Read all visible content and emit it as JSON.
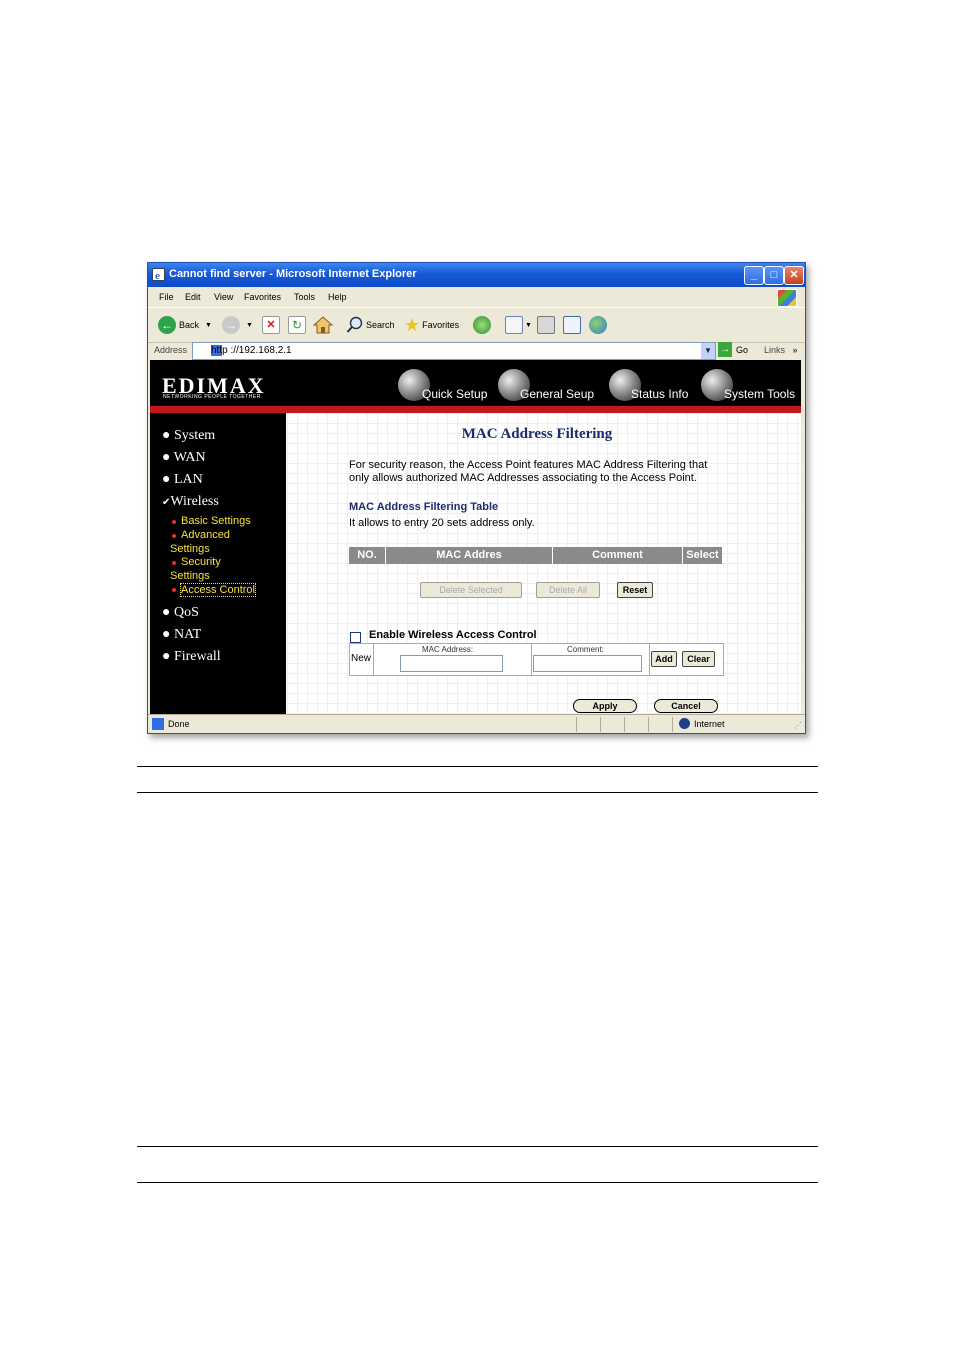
{
  "window": {
    "title": "Cannot find server - Microsoft Internet Explorer",
    "min_glyph": "_",
    "max_glyph": "□",
    "close_glyph": "✕"
  },
  "menu": [
    "File",
    "Edit",
    "View",
    "Favorites",
    "Tools",
    "Help"
  ],
  "toolbar": {
    "back": "Back",
    "search": "Search",
    "favorites": "Favorites"
  },
  "address": {
    "label": "Address",
    "url": "http ://192.168.2.1",
    "go": "Go",
    "links": "Links",
    "links_more": "»"
  },
  "banner": {
    "logo": "EDIMAX",
    "tagline": "NETWORKING PEOPLE TOGETHER",
    "nav": [
      "Quick Setup",
      "General Seup",
      "Status Info",
      "System Tools"
    ]
  },
  "sidebar": {
    "items": [
      "System",
      "WAN",
      "LAN",
      "Wireless",
      "QoS",
      "NAT",
      "Firewall"
    ],
    "wireless_sub": [
      "Basic Settings",
      "Advanced",
      "Settings",
      "Security",
      "Settings",
      "Access Control"
    ]
  },
  "main": {
    "title": "MAC Address Filtering",
    "desc_line1": "For security reason, the Access Point features MAC Address Filtering that",
    "desc_line2": "only allows authorized MAC Addresses associating to the Access Point.",
    "table_title": "MAC Address Filtering Table",
    "table_note": "It allows to entry 20 sets address only.",
    "columns": [
      "NO.",
      "MAC Addres",
      "Comment",
      "Select"
    ],
    "delete_selected": "Delete Selected",
    "delete_all": "Delete All",
    "reset": "Reset",
    "enable_label": "Enable Wireless Access Control",
    "new_label": "New",
    "mac_label": "MAC Address:",
    "comment_label": "Comment:",
    "add": "Add",
    "clear": "Clear",
    "apply": "Apply",
    "cancel": "Cancel"
  },
  "status": {
    "text": "Done",
    "zone": "Internet"
  },
  "colors": {
    "title_blue": "#1c2c6e",
    "sidebar_yellow": "#f5e33a",
    "banner_red": "#c4161c"
  }
}
